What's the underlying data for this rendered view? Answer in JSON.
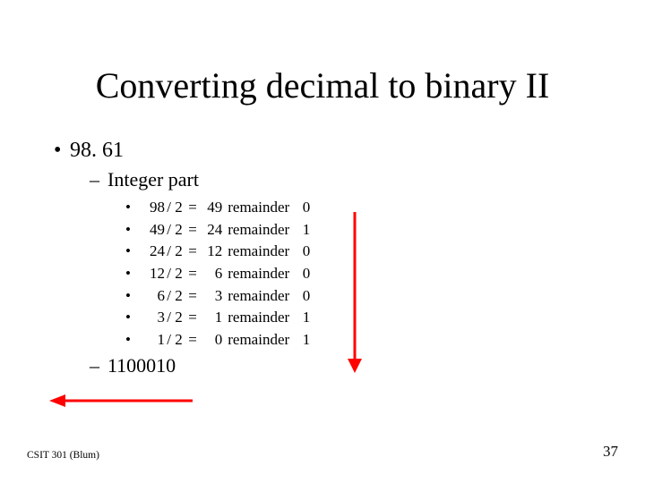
{
  "title": "Converting decimal to binary II",
  "number_example": "98. 61",
  "section_label": "Integer part",
  "rows": [
    {
      "dividend": "98",
      "divisor": "2",
      "quotient": "49",
      "remainder_word": "remainder",
      "remainder": "0"
    },
    {
      "dividend": "49",
      "divisor": "2",
      "quotient": "24",
      "remainder_word": "remainder",
      "remainder": "1"
    },
    {
      "dividend": "24",
      "divisor": "2",
      "quotient": "12",
      "remainder_word": "remainder",
      "remainder": "0"
    },
    {
      "dividend": "12",
      "divisor": "2",
      "quotient": "6",
      "remainder_word": "remainder",
      "remainder": "0"
    },
    {
      "dividend": "6",
      "divisor": "2",
      "quotient": "3",
      "remainder_word": "remainder",
      "remainder": "0"
    },
    {
      "dividend": "3",
      "divisor": "2",
      "quotient": "1",
      "remainder_word": "remainder",
      "remainder": "1"
    },
    {
      "dividend": "1",
      "divisor": "2",
      "quotient": "0",
      "remainder_word": "remainder",
      "remainder": "1"
    }
  ],
  "result": "1100010",
  "footer": {
    "left": "CSIT 301 (Blum)",
    "right": "37"
  },
  "arrow_color": "#ff0000"
}
